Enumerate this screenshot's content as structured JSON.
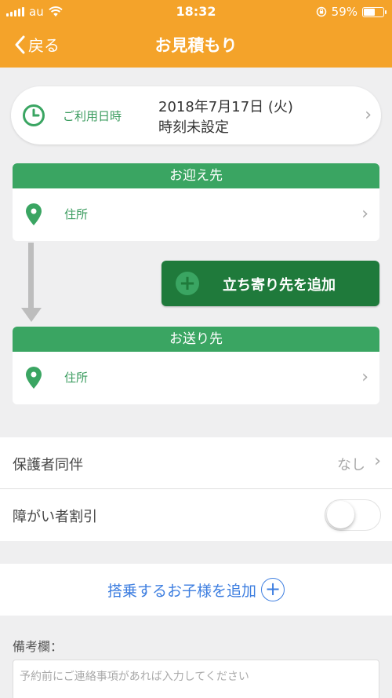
{
  "status": {
    "carrier": "au",
    "time": "18:32",
    "battery": "59%",
    "battery_level": 0.59
  },
  "nav": {
    "back_label": "戻る",
    "title": "お見積もり"
  },
  "usage": {
    "label": "ご利用日時",
    "date": "2018年7月17日 (火)",
    "time": "時刻未設定"
  },
  "pickup": {
    "header": "お迎え先",
    "address_label": "住所"
  },
  "add_stop": {
    "label": "立ち寄り先を追加"
  },
  "dropoff": {
    "header": "お送り先",
    "address_label": "住所"
  },
  "guardian": {
    "label": "保護者同伴",
    "value": "なし"
  },
  "discount": {
    "label": "障がい者割引",
    "enabled": false
  },
  "add_child": {
    "label": "搭乗するお子様を追加"
  },
  "remarks": {
    "label": "備考欄：",
    "placeholder": "予約前にご連絡事項があれば入力してください"
  },
  "colors": {
    "header": "#f4a32a",
    "accent_green": "#3aa562",
    "dark_green": "#1f7a3b",
    "link_blue": "#3d7ee0"
  }
}
